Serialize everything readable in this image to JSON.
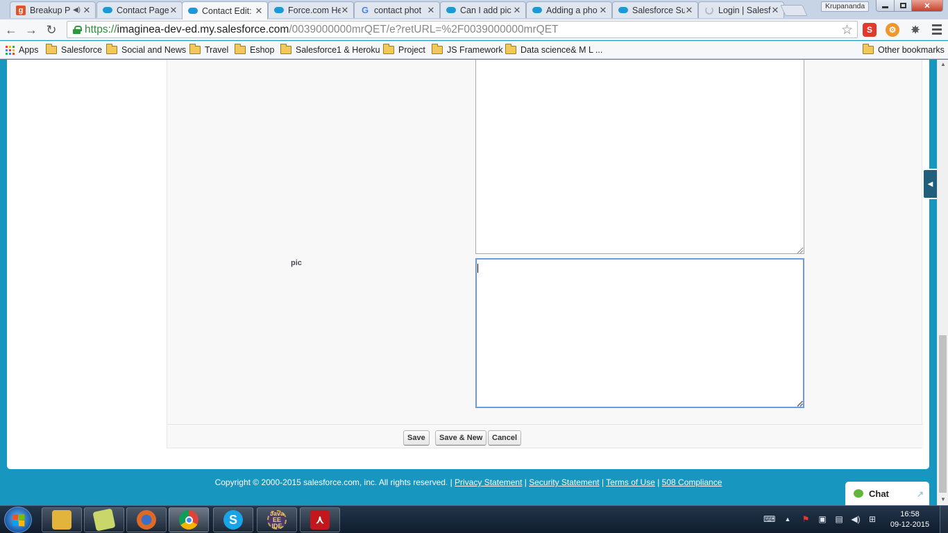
{
  "browser": {
    "tabs": [
      {
        "title": "Breakup P",
        "extra": "◀)",
        "favicon_color": "#e0542c",
        "favicon_letter": "g"
      },
      {
        "title": "Contact Page",
        "favicon_color": "#1a9bd7"
      },
      {
        "title": "Contact Edit:",
        "favicon_color": "#1a9bd7",
        "active": true
      },
      {
        "title": "Force.com He",
        "favicon_color": "#1a9bd7"
      },
      {
        "title": "contact phot",
        "favicon_color": "#4285f4",
        "favicon_letter": "G"
      },
      {
        "title": "Can I add pic",
        "favicon_color": "#1a9bd7"
      },
      {
        "title": "Adding a pho",
        "favicon_color": "#1a9bd7"
      },
      {
        "title": "Salesforce Su",
        "favicon_color": "#1a9bd7"
      },
      {
        "title": "Login | Salesf",
        "favicon_color": "#9aa4ae"
      }
    ],
    "profile_name": "Krupananda",
    "url": {
      "scheme": "https://",
      "host": "imaginea-dev-ed.my.salesforce.com",
      "path": "/0039000000mrQET/e?retURL=%2F0039000000mrQET"
    },
    "bookmarks": [
      {
        "label": "Apps",
        "type": "apps"
      },
      {
        "label": "Salesforce"
      },
      {
        "label": "Social and News"
      },
      {
        "label": "Travel"
      },
      {
        "label": "Eshop"
      },
      {
        "label": "Salesforce1 & Heroku"
      },
      {
        "label": "Project"
      },
      {
        "label": "JS Framework"
      },
      {
        "label": "Data science& M L ..."
      }
    ],
    "other_bookmarks": "Other bookmarks"
  },
  "form": {
    "pic_label": "pic",
    "pic_value": "",
    "buttons": {
      "save": "Save",
      "save_new": "Save & New",
      "cancel": "Cancel"
    }
  },
  "footer": {
    "copyright": "Copyright © 2000-2015 salesforce.com, inc. All rights reserved. | ",
    "privacy": "Privacy Statement",
    "sep1": " | ",
    "security": "Security Statement",
    "sep2": " | ",
    "terms": "Terms of Use",
    "sep3": " | ",
    "compliance": "508 Compliance"
  },
  "chat": {
    "label": "Chat"
  },
  "taskbar": {
    "apps": [
      {
        "name": "file-explorer",
        "color": "#e2b43b"
      },
      {
        "name": "sticky-notes",
        "color": "#c9d76a"
      },
      {
        "name": "firefox",
        "color": "#e06a23"
      },
      {
        "name": "chrome",
        "color": "#3c9f4a"
      },
      {
        "name": "skype",
        "color": "#1aa4e8",
        "letter": "S"
      },
      {
        "name": "java-ee-ide",
        "color": "#4a3a6a",
        "letter": "Java EE IDE"
      },
      {
        "name": "acrobat",
        "color": "#c1171d"
      }
    ],
    "time": "16:58",
    "date": "09-12-2015"
  },
  "colors": {
    "salesforce_bg": "#1797c0",
    "url_green": "#2c8f39",
    "focus_border": "#6b9be0"
  }
}
